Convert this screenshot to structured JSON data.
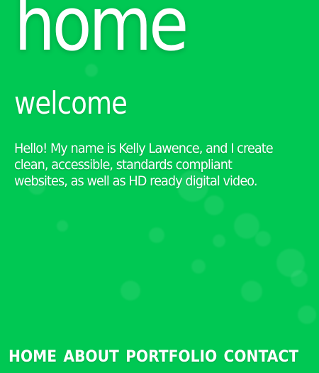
{
  "page": {
    "hero_title": "home",
    "subtitle": "welcome",
    "intro_text": "Hello! My name is Kelly Lawence, and I create clean, accessible, standards compliant websites, as well as HD ready digital video."
  },
  "nav": {
    "items": [
      {
        "label": "HOME"
      },
      {
        "label": "ABOUT"
      },
      {
        "label": "PORTFOLIO"
      },
      {
        "label": "CONTACT"
      }
    ]
  },
  "colors": {
    "background": "#00c853",
    "text": "#ffffff"
  }
}
